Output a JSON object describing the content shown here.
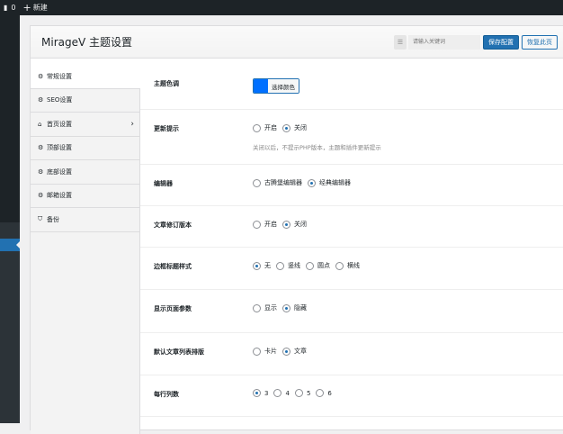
{
  "adminbar": {
    "comments": "0",
    "new": "新建"
  },
  "header": {
    "title": "MirageV 主题设置",
    "search_placeholder": "请输入关键词",
    "save": "保存配置",
    "restore": "恢复此页"
  },
  "nav": [
    {
      "label": "常规设置",
      "icon": "gear"
    },
    {
      "label": "SEO设置",
      "icon": "gear"
    },
    {
      "label": "首页设置",
      "icon": "home"
    },
    {
      "label": "顶部设置",
      "icon": "gear"
    },
    {
      "label": "底部设置",
      "icon": "gear"
    },
    {
      "label": "邮箱设置",
      "icon": "gear"
    },
    {
      "label": "备份",
      "icon": "backup"
    }
  ],
  "settings": {
    "color": {
      "label": "主题色调",
      "button": "选择颜色",
      "value": "#0070ff"
    },
    "update": {
      "label": "更新提示",
      "options": [
        "开启",
        "关闭"
      ],
      "selected": 1,
      "desc": "关闭以后，不提示PHP版本，主题和插件更新提示"
    },
    "editor": {
      "label": "编辑器",
      "options": [
        "古腾堡编辑器",
        "经典编辑器"
      ],
      "selected": 1
    },
    "revision": {
      "label": "文章修订版本",
      "options": [
        "开启",
        "关闭"
      ],
      "selected": 1
    },
    "border": {
      "label": "边框标题样式",
      "options": [
        "无",
        "竖线",
        "圆点",
        "横线"
      ],
      "selected": 0
    },
    "params": {
      "label": "显示页面参数",
      "options": [
        "显示",
        "隐藏"
      ],
      "selected": 1
    },
    "layout": {
      "label": "默认文章列表排版",
      "options": [
        "卡片",
        "文章"
      ],
      "selected": 1
    },
    "columns": {
      "label": "每行列数",
      "options": [
        "3",
        "4",
        "5",
        "6"
      ],
      "selected": 0
    }
  }
}
